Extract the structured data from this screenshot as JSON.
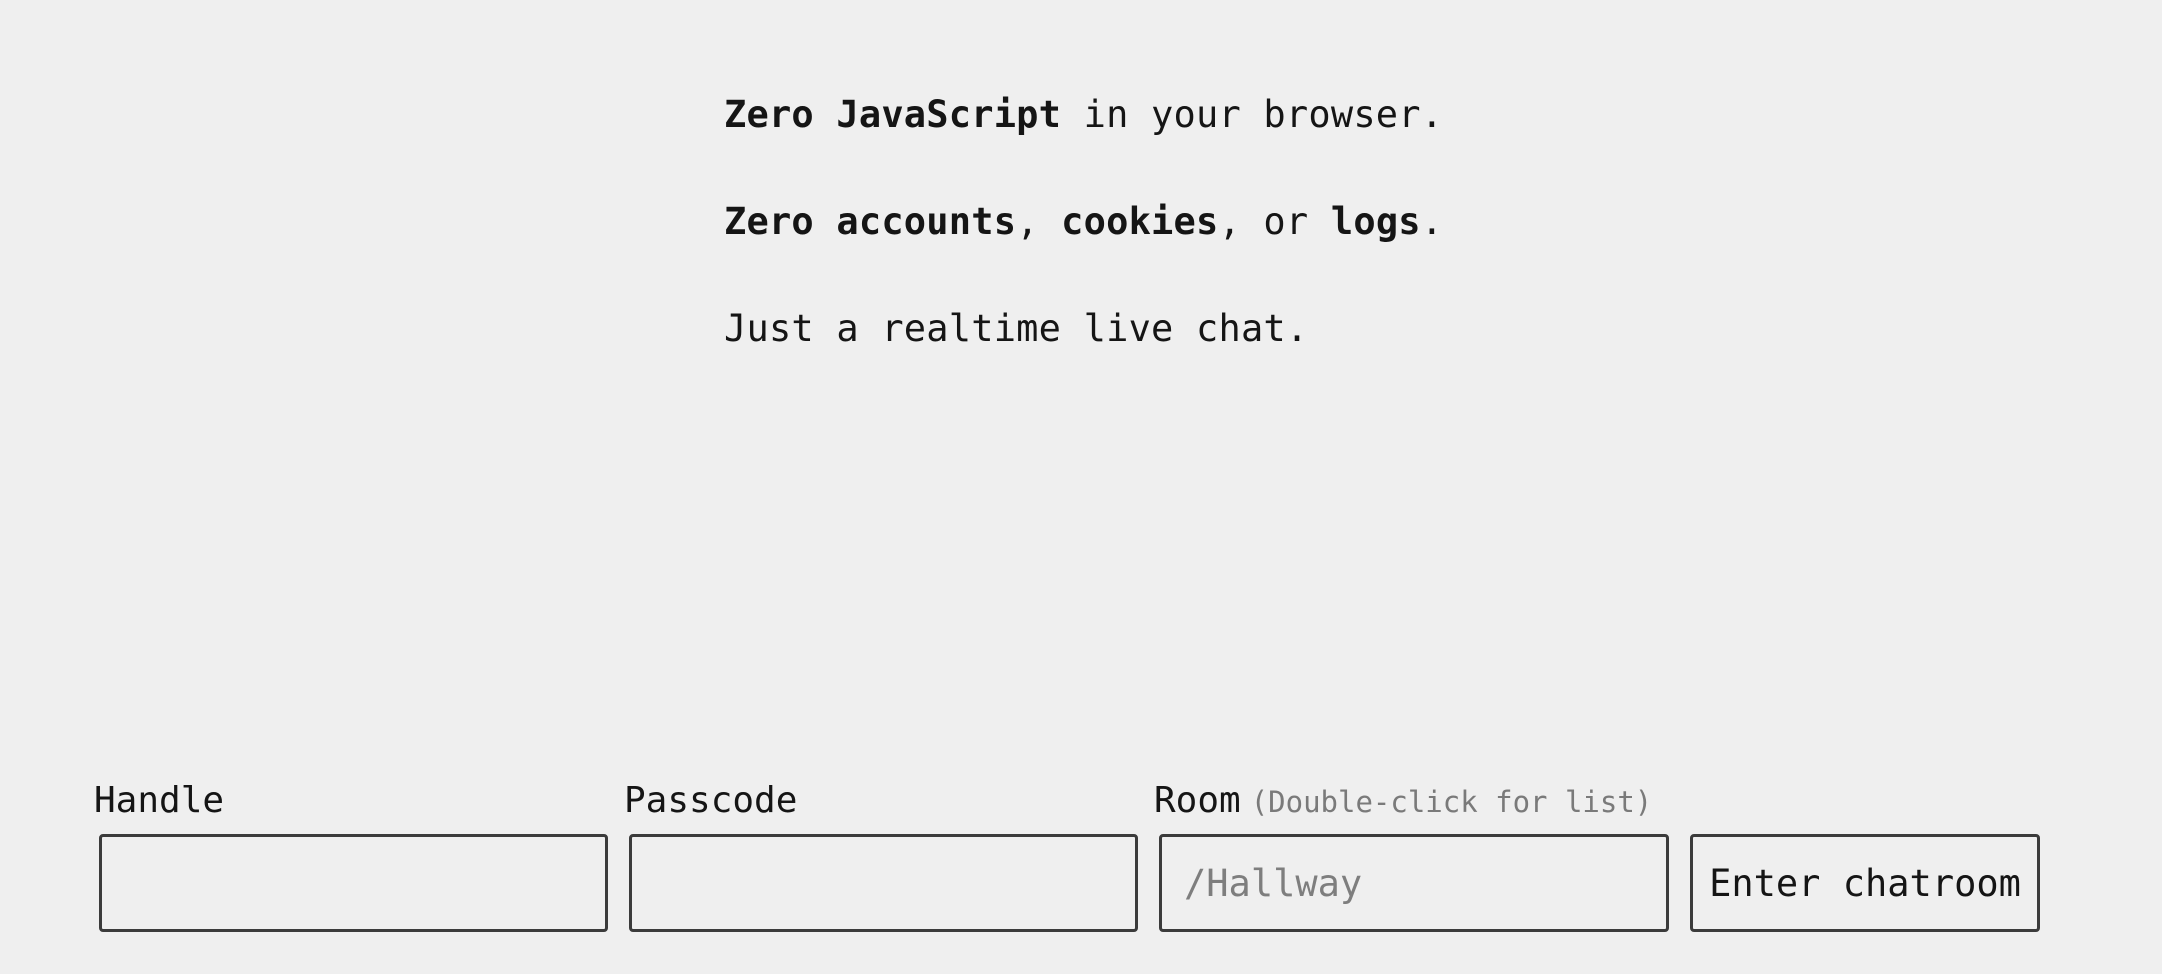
{
  "intro": {
    "line1": {
      "bold": "Zero JavaScript",
      "rest": " in your browser."
    },
    "line2": {
      "bold1": "Zero accounts",
      "sep1": ", ",
      "bold2": "cookies",
      "sep2": ", or ",
      "bold3": "logs",
      "end": "."
    },
    "line3": "Just a realtime live chat."
  },
  "form": {
    "handle": {
      "label": "Handle",
      "value": "",
      "placeholder": ""
    },
    "passcode": {
      "label": "Passcode",
      "value": "",
      "placeholder": ""
    },
    "room": {
      "label": "Room",
      "hint": "(Double-click for list)",
      "value": "",
      "placeholder": "/Hallway"
    },
    "submit_label": "Enter chatroom"
  },
  "colors": {
    "background": "#efefef",
    "text": "#151515",
    "border": "#3b3b3b",
    "muted": "#7a7a7a"
  }
}
